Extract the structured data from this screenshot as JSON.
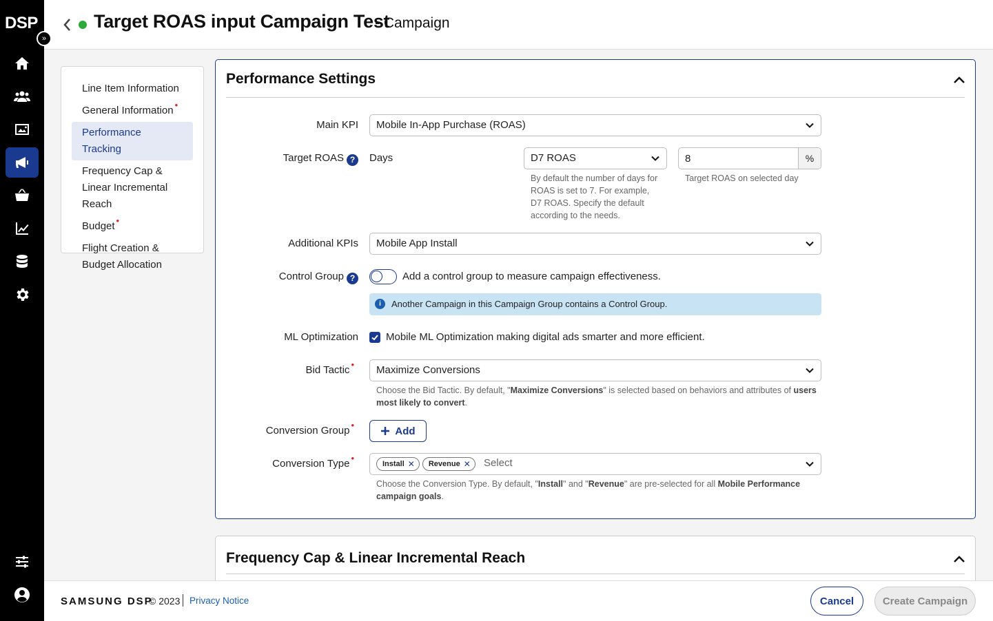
{
  "app": {
    "logo": "DSP",
    "expand_glyph": "»"
  },
  "header": {
    "title": "Target ROAS input Campaign Test",
    "subtitle": "- Campaign",
    "status_color": "#2eaa3c"
  },
  "rail_icons": [
    "home-icon",
    "audience-icon",
    "creative-icon",
    "campaign-icon",
    "inventory-icon",
    "reports-icon",
    "data-icon",
    "settings-icon",
    "filters-icon",
    "user-icon"
  ],
  "nav": {
    "items": [
      {
        "label": "Line Item Information"
      },
      {
        "label": "General Information",
        "required": "•"
      },
      {
        "label": "Performance Tracking"
      },
      {
        "label": "Frequency Cap &\nLinear Incremental Reach"
      },
      {
        "label": "Budget",
        "required": "•"
      },
      {
        "label": "Flight Creation &\nBudget Allocation"
      }
    ]
  },
  "performance": {
    "title": "Performance Settings",
    "main_kpi": {
      "label": "Main KPI",
      "value": "Mobile In-App Purchase (ROAS)"
    },
    "target_roas": {
      "label": "Target ROAS",
      "help": "?",
      "days_label": "Days",
      "days_value": "D7 ROAS",
      "days_hint": "By default the number of days for ROAS is set to 7. For example, D7 ROAS. Specify the default according to the needs.",
      "value": "8",
      "unit": "%",
      "value_hint": "Target ROAS on selected day"
    },
    "additional_kpis": {
      "label": "Additional KPIs",
      "value": "Mobile App Install"
    },
    "control_group": {
      "label": "Control Group",
      "help": "?",
      "toggle_text": "Add a control group to measure campaign effectiveness.",
      "info": "Another Campaign in this Campaign Group contains a Control Group.",
      "info_glyph": "i"
    },
    "ml_optimization": {
      "label": "ML Optimization",
      "text": "Mobile ML Optimization making digital ads smarter and more efficient."
    },
    "bid_tactic": {
      "label": "Bid Tactic",
      "required": "•",
      "value": "Maximize Conversions",
      "hint_prefix": "Choose the Bid Tactic. By default, \"",
      "hint_bold1": "Maximize Conversions",
      "hint_mid": "\" is selected based on behaviors and attributes of ",
      "hint_bold2": "users most likely to convert",
      "hint_suffix": "."
    },
    "conversion_group": {
      "label": "Conversion Group",
      "required": "•",
      "add_label": "Add"
    },
    "conversion_type": {
      "label": "Conversion Type",
      "required": "•",
      "chips": [
        "Install",
        "Revenue"
      ],
      "chip_remove": "✕",
      "placeholder": "Select",
      "hint_prefix": "Choose the Conversion Type. By default, \"",
      "hint_bold1": "Install",
      "hint_mid1": "\" and \"",
      "hint_bold2": "Revenue",
      "hint_mid2": "\" are pre-selected for all ",
      "hint_bold3": "Mobile Performance campaign goals",
      "hint_suffix": "."
    }
  },
  "frequency": {
    "title": "Frequency Cap & Linear Incremental Reach"
  },
  "footer": {
    "brand": "SAMSUNG DSP",
    "copyright": "© 2023",
    "privacy": "Privacy Notice",
    "cancel": "Cancel",
    "create": "Create Campaign"
  }
}
